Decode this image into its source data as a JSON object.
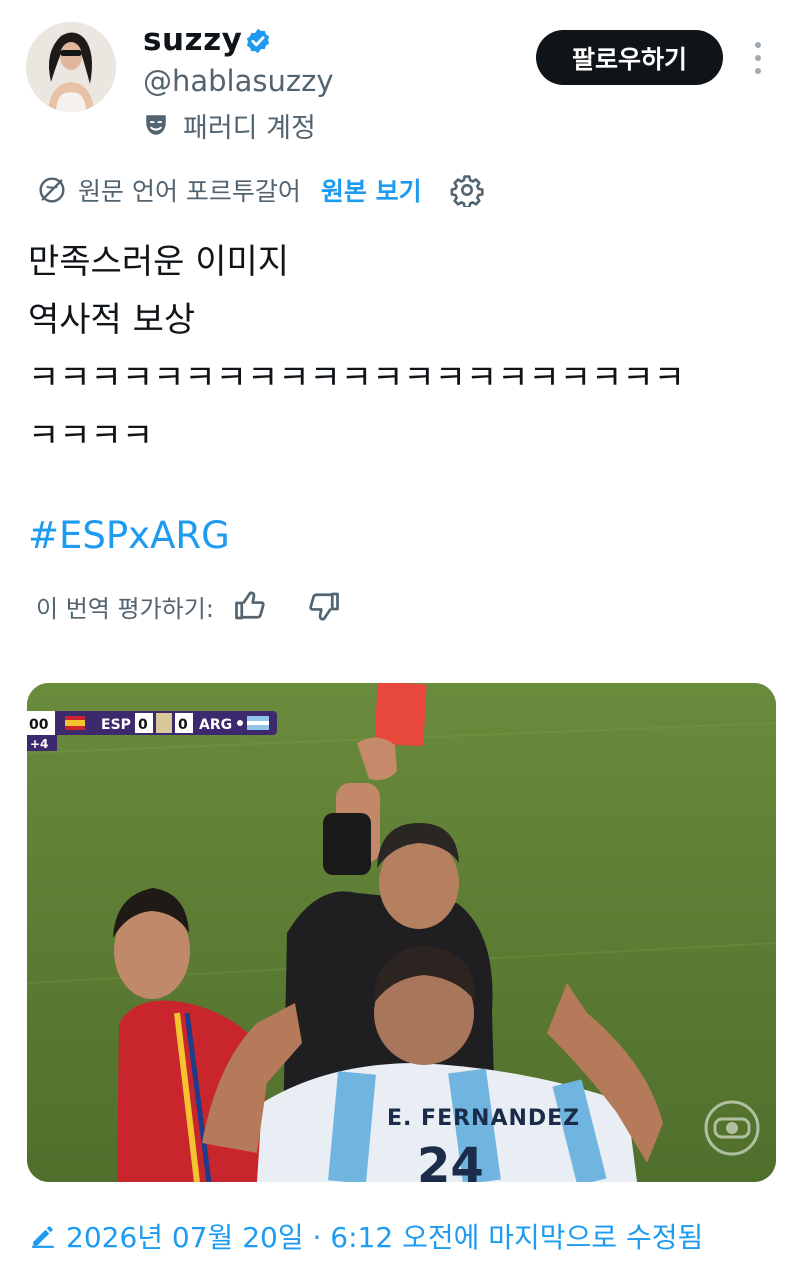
{
  "author": {
    "display_name": "suzzy",
    "handle": "@hablasuzzy",
    "parody_label": "패러디 계정",
    "verified": true
  },
  "actions": {
    "follow_label": "팔로우하기"
  },
  "translation": {
    "label": "원문 언어 포르투갈어",
    "show_original": "원본 보기"
  },
  "tweet": {
    "lines": [
      "만족스러운 이미지",
      "역사적 보상",
      "ㅋㅋㅋㅋㅋㅋㅋㅋㅋㅋㅋㅋㅋㅋㅋㅋㅋㅋㅋㅋㅋ",
      "ㅋㅋㅋㅋ"
    ],
    "hashtag": "#ESPxARG"
  },
  "rating": {
    "label": "이 번역 평가하기:"
  },
  "media": {
    "scoreboard": {
      "time": "00",
      "home_team": "ESP",
      "home_score": "0",
      "away_score": "0",
      "away_team": "ARG",
      "added_time": "+4"
    },
    "jersey_name": "E. FERNANDEZ",
    "jersey_number": "24"
  },
  "footer": {
    "edited_text": "2026년 07월 20일 · 6:12 오전에 마지막으로 수정됨"
  },
  "colors": {
    "accent": "#1d9bf0",
    "text_primary": "#0f1419",
    "text_secondary": "#536471",
    "pitch_green": "#5f7e35",
    "red_card": "#e8473b"
  }
}
